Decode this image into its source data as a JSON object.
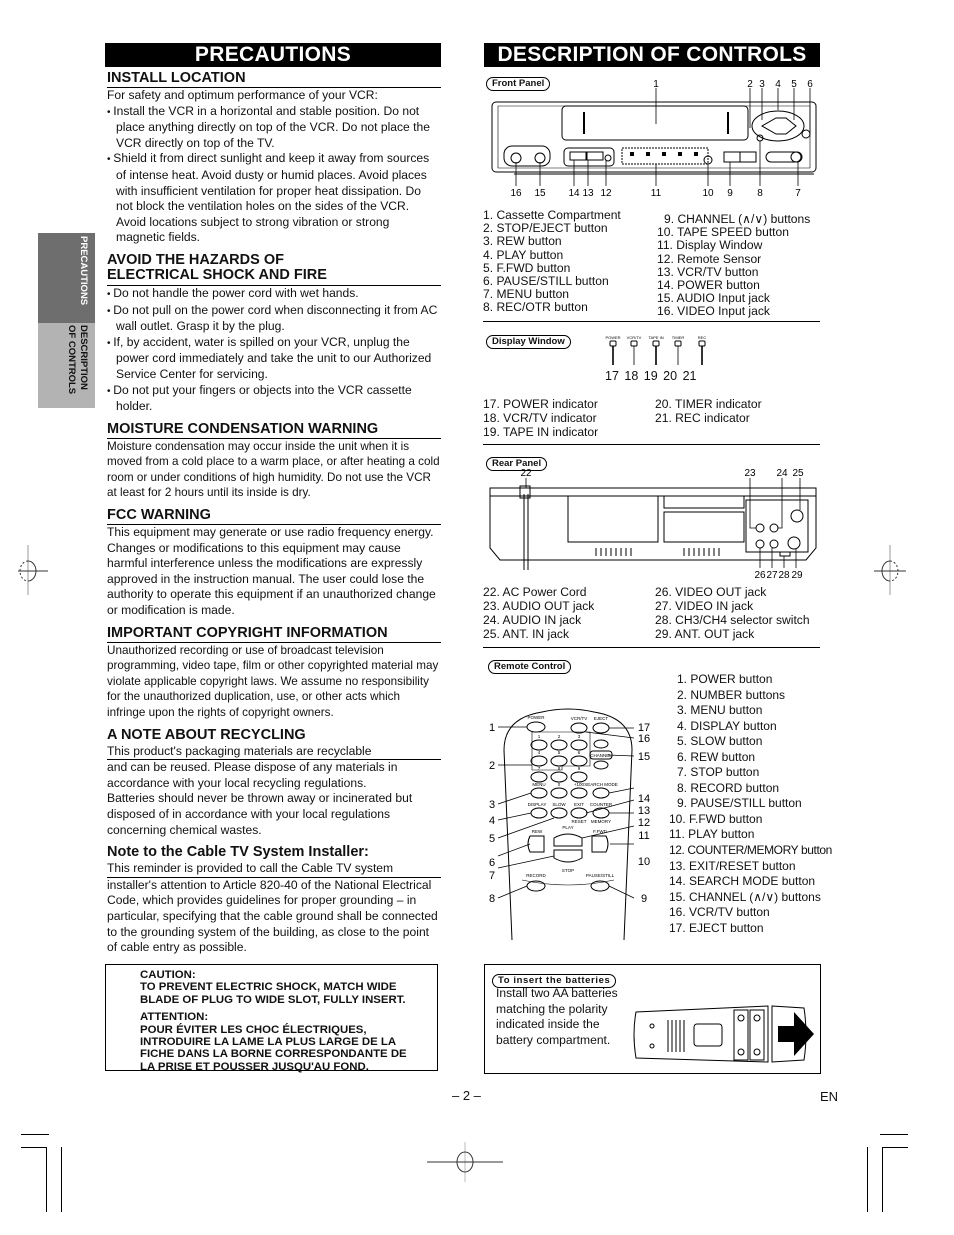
{
  "precautions": {
    "title": "PRECAUTIONS",
    "install": {
      "heading": "INSTALL LOCATION",
      "intro": "For safety and optimum performance of your VCR:",
      "bullets": [
        "Install the VCR in a horizontal and stable position. Do not place anything directly on top of the VCR. Do not place the VCR directly on top of the TV.",
        "Shield it from direct sunlight and keep it away from sources of intense heat. Avoid dusty or humid places. Avoid places with insufficient ventilation for proper heat dissipation. Do not block the ventilation holes on the sides of the VCR. Avoid locations subject to strong vibration or strong magnetic fields."
      ]
    },
    "hazards": {
      "heading_line1": "AVOID THE HAZARDS OF",
      "heading_line2": "ELECTRICAL SHOCK AND FIRE",
      "bullets": [
        "Do not handle the power cord with wet hands.",
        "Do not pull on the power cord when disconnecting it from AC wall outlet. Grasp it by the plug.",
        "If, by accident, water is spilled on your VCR, unplug the power cord immediately and take the unit to our Authorized Service Center for servicing.",
        "Do not put your fingers or objects into the VCR cassette holder."
      ]
    },
    "moisture": {
      "heading": "MOISTURE CONDENSATION WARNING",
      "body": "Moisture condensation may occur inside the unit when it is moved from a cold place to a warm place, or after heating a cold room or under conditions of high humidity. Do not use the VCR at least for 2 hours until its inside is dry."
    },
    "fcc": {
      "heading": "FCC WARNING",
      "body": "This equipment may generate or use radio frequency energy. Changes or modifications to this equipment may cause harmful interference unless the modifications are expressly approved in the instruction manual. The user could lose the authority to operate this equipment if an unauthorized change or modification is made."
    },
    "copyright": {
      "heading": "IMPORTANT COPYRIGHT INFORMATION",
      "body": "Unauthorized recording or use of broadcast television programming, video tape, film or other copyrighted material may violate applicable copyright laws. We assume no responsibility for the unauthorized duplication, use, or other acts which infringe upon the rights of copyright owners."
    },
    "recycling": {
      "heading": "A NOTE ABOUT RECYCLING",
      "first_line": "This product's packaging materials are recyclable",
      "body": "and can be reused. Please dispose of any materials in accordance with your local recycling regulations. Batteries should never be thrown away or incinerated but disposed of in accordance with your local regulations concerning chemical wastes."
    },
    "cable": {
      "heading": "Note to the Cable TV System Installer:",
      "first_line": "This reminder is provided to call the Cable TV system",
      "body": "installer's attention to Article 820-40 of the National Electrical Code, which provides guidelines for proper grounding – in particular, specifying that the cable ground shall be connected to the grounding system of the building, as close to the point of cable entry as possible."
    },
    "caution": {
      "title": "CAUTION:",
      "line1": "TO PREVENT ELECTRIC SHOCK, MATCH WIDE",
      "line2": "BLADE OF PLUG TO WIDE SLOT, FULLY INSERT.",
      "attention_title": "ATTENTION:",
      "fr1": "POUR ÉVITER LES CHOC ÉLECTRIQUES,",
      "fr2": "INTRODUIRE LA LAME LA PLUS LARGE DE LA",
      "fr3": "FICHE DANS LA BORNE CORRESPONDANTE DE",
      "fr4": "LA PRISE ET POUSSER JUSQU'AU FOND."
    }
  },
  "sidetab": {
    "active": "PRECAUTIONS",
    "inactive_line1": "DESCRIPTION",
    "inactive_line2": "OF CONTROLS"
  },
  "controls": {
    "title": "DESCRIPTION OF CONTROLS",
    "front_panel": {
      "label": "Front Panel",
      "callouts_top": [
        "1",
        "2",
        "3",
        "4",
        "5",
        "6"
      ],
      "callouts_bottom": [
        "16",
        "15",
        "14",
        "13",
        "12",
        "11",
        "10",
        "9",
        "8",
        "7"
      ],
      "items_left": [
        "1. Cassette Compartment",
        "2. STOP/EJECT button",
        "3. REW button",
        "4. PLAY button",
        "5. F.FWD button",
        "6. PAUSE/STILL button",
        "7. MENU button",
        "8. REC/OTR button"
      ],
      "items_right": [
        "9. CHANNEL (∧/∨) buttons",
        "10. TAPE SPEED button",
        "11. Display Window",
        "12. Remote Sensor",
        "13. VCR/TV button",
        "14. POWER button",
        "15. AUDIO Input jack",
        "16. VIDEO Input jack"
      ]
    },
    "display_window": {
      "label": "Display Window",
      "indicator_labels": [
        "POWER",
        "VCR/TV",
        "TAPE IN",
        "TIMER",
        "REC"
      ],
      "callouts": [
        "17",
        "18",
        "19",
        "20",
        "21"
      ],
      "items_left": [
        "17. POWER indicator",
        "18. VCR/TV indicator",
        "19. TAPE IN indicator"
      ],
      "items_right": [
        "20. TIMER indicator",
        "21. REC indicator"
      ]
    },
    "rear_panel": {
      "label": "Rear Panel",
      "callouts_top": [
        "22",
        "23",
        "24",
        "25"
      ],
      "callouts_bottom": [
        "26",
        "27",
        "28",
        "29"
      ],
      "items_left": [
        "22. AC Power Cord",
        "23. AUDIO OUT jack",
        "24. AUDIO IN jack",
        "25. ANT. IN jack"
      ],
      "items_right": [
        "26. VIDEO OUT jack",
        "27. VIDEO IN jack",
        "28. CH3/CH4 selector switch",
        "29. ANT. OUT jack"
      ]
    },
    "remote": {
      "label": "Remote Control",
      "callouts_left": [
        "1",
        "2",
        "3",
        "4",
        "5",
        "6",
        "7",
        "8"
      ],
      "callouts_right": [
        "17",
        "16",
        "15",
        "14",
        "13",
        "12",
        "11",
        "10",
        "9"
      ],
      "button_labels": {
        "power": "POWER",
        "vcrtv": "VCR/TV",
        "eject": "EJECT",
        "channel": "CHANNEL",
        "menu": "MENU",
        "zero": "0",
        "plus100": "+100",
        "search": "SEARCH MODE",
        "display": "DISPLAY",
        "slow": "SLOW",
        "exit": "EXIT",
        "counter": "COUNTER",
        "reset": "RESET",
        "memory": "MEMORY",
        "play": "PLAY",
        "rew": "REW",
        "ffwd": "F.FWD",
        "stop": "STOP",
        "record": "RECORD",
        "pause": "PAUSE/STILL"
      },
      "digits": [
        "1",
        "2",
        "3",
        "4",
        "5",
        "6",
        "7",
        "8",
        "9"
      ],
      "items": [
        "1. POWER button",
        "2. NUMBER buttons",
        "3. MENU button",
        "4. DISPLAY button",
        "5. SLOW button",
        "6. REW button",
        "7. STOP button",
        "8. RECORD button",
        "9. PAUSE/STILL button",
        "10. F.FWD button",
        "11. PLAY button",
        "12. COUNTER/MEMORY button",
        "13. EXIT/RESET button",
        "14. SEARCH MODE button",
        "15. CHANNEL (∧/∨) buttons",
        "16. VCR/TV button",
        "17. EJECT button"
      ]
    },
    "batteries": {
      "label": "To insert the batteries",
      "body": "Install two AA batteries matching the polarity indicated inside the battery compartment."
    }
  },
  "footer": {
    "page_number": "– 2 –",
    "language": "EN"
  }
}
